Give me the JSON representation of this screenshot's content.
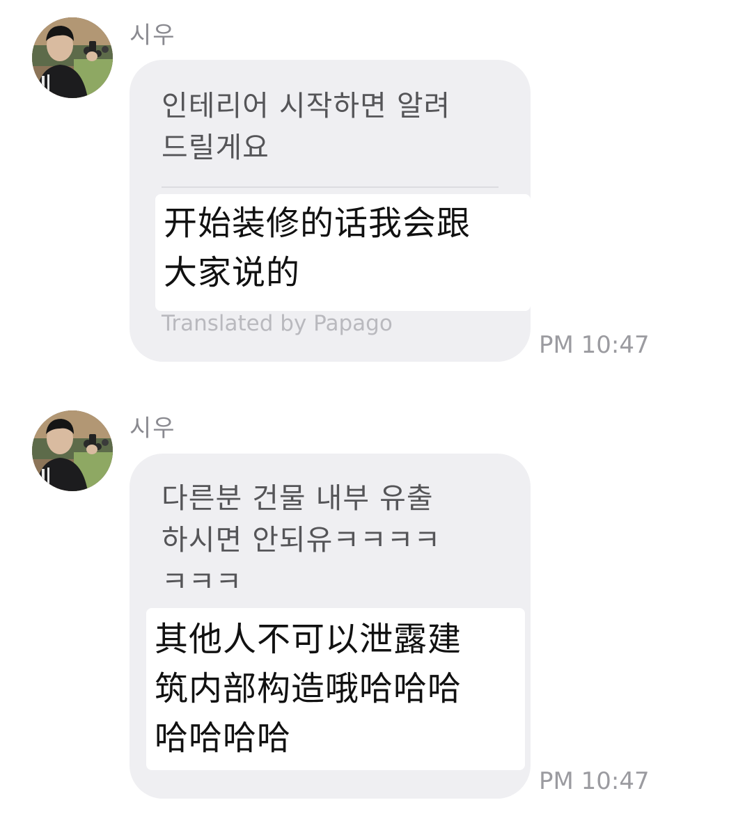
{
  "messages": [
    {
      "sender": "시우",
      "original_text": "인테리어 시작하면 알려\n드릴게요",
      "translated_text": "开始装修的话我会跟\n大家说的",
      "translation_credit": "Translated by Papago",
      "time": "PM 10:47"
    },
    {
      "sender": "시우",
      "original_text": "다른분 건물 내부 유출\n하시면 안되유ㅋㅋㅋㅋ\nㅋㅋㅋ",
      "translated_text": "其他人不可以泄露建\n筑内部构造哦哈哈哈\n哈哈哈哈",
      "time": "PM 10:47"
    }
  ],
  "icons": {
    "avatar": "profile-photo"
  }
}
